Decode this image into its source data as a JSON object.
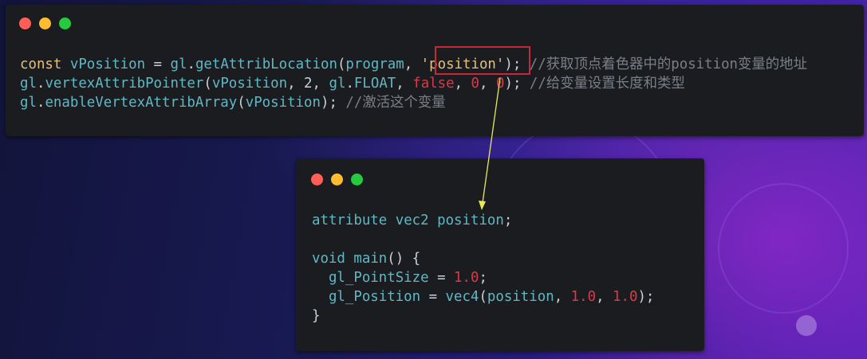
{
  "top_window": {
    "window_controls": [
      "close",
      "minimize",
      "maximize"
    ],
    "lines": [
      [
        {
          "t": "const",
          "c": "kw"
        },
        {
          "t": " ",
          "c": "pl"
        },
        {
          "t": "vPosition",
          "c": "var"
        },
        {
          "t": " = ",
          "c": "pl"
        },
        {
          "t": "gl",
          "c": "var"
        },
        {
          "t": ".",
          "c": "pl"
        },
        {
          "t": "getAttribLocation",
          "c": "fn"
        },
        {
          "t": "(",
          "c": "pl"
        },
        {
          "t": "program",
          "c": "var"
        },
        {
          "t": ", ",
          "c": "pl"
        },
        {
          "t": "'position'",
          "c": "str"
        },
        {
          "t": "); ",
          "c": "pl"
        },
        {
          "t": "//获取顶点着色器中的position变量的地址",
          "c": "cm"
        }
      ],
      [
        {
          "t": "gl",
          "c": "var"
        },
        {
          "t": ".",
          "c": "pl"
        },
        {
          "t": "vertexAttribPointer",
          "c": "fn"
        },
        {
          "t": "(",
          "c": "pl"
        },
        {
          "t": "vPosition",
          "c": "var"
        },
        {
          "t": ", ",
          "c": "pl"
        },
        {
          "t": "2",
          "c": "pl"
        },
        {
          "t": ", ",
          "c": "pl"
        },
        {
          "t": "gl",
          "c": "var"
        },
        {
          "t": ".",
          "c": "pl"
        },
        {
          "t": "FLOAT",
          "c": "var"
        },
        {
          "t": ", ",
          "c": "pl"
        },
        {
          "t": "false",
          "c": "bool"
        },
        {
          "t": ", ",
          "c": "pl"
        },
        {
          "t": "0",
          "c": "num"
        },
        {
          "t": ", ",
          "c": "pl"
        },
        {
          "t": "0",
          "c": "num"
        },
        {
          "t": "); ",
          "c": "pl"
        },
        {
          "t": "//给变量设置长度和类型",
          "c": "cm"
        }
      ],
      [
        {
          "t": "gl",
          "c": "var"
        },
        {
          "t": ".",
          "c": "pl"
        },
        {
          "t": "enableVertexAttribArray",
          "c": "fn"
        },
        {
          "t": "(",
          "c": "pl"
        },
        {
          "t": "vPosition",
          "c": "var"
        },
        {
          "t": "); ",
          "c": "pl"
        },
        {
          "t": "//激活这个变量",
          "c": "cm"
        }
      ]
    ]
  },
  "bottom_window": {
    "window_controls": [
      "close",
      "minimize",
      "maximize"
    ],
    "lines": [
      [
        {
          "t": "attribute",
          "c": "ty"
        },
        {
          "t": " ",
          "c": "pl"
        },
        {
          "t": "vec2",
          "c": "ty"
        },
        {
          "t": " ",
          "c": "pl"
        },
        {
          "t": "position",
          "c": "var"
        },
        {
          "t": ";",
          "c": "pl"
        }
      ],
      [],
      [
        {
          "t": "void",
          "c": "ty"
        },
        {
          "t": " ",
          "c": "pl"
        },
        {
          "t": "main",
          "c": "fn"
        },
        {
          "t": "() {",
          "c": "pl"
        }
      ],
      [
        {
          "t": "  ",
          "c": "pl"
        },
        {
          "t": "gl_PointSize",
          "c": "var"
        },
        {
          "t": " = ",
          "c": "pl"
        },
        {
          "t": "1.0",
          "c": "num"
        },
        {
          "t": ";",
          "c": "pl"
        }
      ],
      [
        {
          "t": "  ",
          "c": "pl"
        },
        {
          "t": "gl_Position",
          "c": "var"
        },
        {
          "t": " = ",
          "c": "pl"
        },
        {
          "t": "vec4",
          "c": "fn"
        },
        {
          "t": "(",
          "c": "pl"
        },
        {
          "t": "position",
          "c": "var"
        },
        {
          "t": ", ",
          "c": "pl"
        },
        {
          "t": "1.0",
          "c": "num"
        },
        {
          "t": ", ",
          "c": "pl"
        },
        {
          "t": "1.0",
          "c": "num"
        },
        {
          "t": ");",
          "c": "pl"
        }
      ],
      [
        {
          "t": "}",
          "c": "pl"
        }
      ]
    ]
  },
  "annotation": {
    "highlight_color": "#c6283a",
    "arrow_color": "#e8e85a",
    "highlighted_token": "'position'"
  },
  "colors": {
    "close": "#ff5f57",
    "minimize": "#febc2e",
    "maximize": "#28c840",
    "editor_bg": "#1b1c1f"
  }
}
